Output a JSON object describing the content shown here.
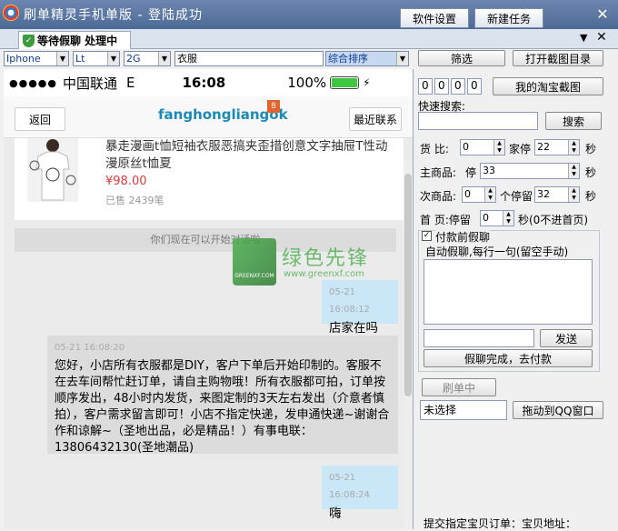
{
  "window": {
    "title": "刷单精灵手机单版 - 登陆成功",
    "software_settings": "软件设置",
    "new_task": "新建任务",
    "close": "✕"
  },
  "tab": {
    "label": "等待假聊 处理中",
    "ctrl": "▼",
    "close": "✕"
  },
  "filters": {
    "device": "Iphone",
    "network": "Lt",
    "signal": "2G",
    "keyword": "衣服",
    "sort": "综合排序"
  },
  "right": {
    "filter_btn": "筛选",
    "open_screenshots_btn": "打开截图目录",
    "digits": [
      "0",
      "0",
      "0",
      "0"
    ],
    "my_taobao_btn": "我的淘宝截图",
    "quick_search_label": "快速搜索:",
    "search_btn": "搜索",
    "goods_compare_label": "货  比:",
    "goods_compare_value": "0",
    "shop_stay_label": "家停",
    "shop_stay_value": "22",
    "sec1": "秒",
    "main_goods_label": "主商品:",
    "stay_label": "停",
    "main_goods_value": "33",
    "sec2": "秒",
    "sub_goods_label": "次商品:",
    "sub_goods_value": "0",
    "each_stay_label": "个停留",
    "sub_stay_value": "32",
    "sec3": "秒",
    "home_label": "首    页:停留",
    "home_value": "0",
    "home_note": "秒(0不进首页)",
    "pay_checkbox_label": "付款前假聊",
    "auto_chat_label": "自动假聊,每行一句(留空手动)",
    "send_btn": "发送",
    "done_btn": "假聊完成，去付款",
    "brush_btn": "刷单中",
    "unselected": "未选择",
    "drag_qq_btn": "拖动到QQ窗口",
    "footer_text": "提交指定宝贝订单：宝贝地址："
  },
  "phone": {
    "signal_dots": "●●●●●",
    "carrier": "中国联通",
    "network": "E",
    "time": "16:08",
    "battery": "100%",
    "back_btn": "返回",
    "contact_name": "fanghongliangok",
    "badge": "8",
    "recent_btn": "最近联系",
    "product_title": "暴走漫画t恤短袖衣服恶搞夹歪措创意文字抽屉T性动漫原丝t恤夏",
    "product_price": "¥98.00",
    "product_sold": "已售 2439笔",
    "system_msg": "你们现在可以开始对话啦",
    "messages": [
      {
        "time": "05-21 16:08:12",
        "text": "店家在吗",
        "side": "right"
      },
      {
        "time": "05-21 16:08:20",
        "text": "您好，小店所有衣服都是DIY，客户下单后开始印制的。客服不在去车间帮忙赶订单，请自主购物哦！所有衣服都可拍，订单按顺序发出，48小时内发货，来图定制的3天左右发出（介意者慎拍），客户需求留言即可！小店不指定快递，发申通快递~谢谢合作和谅解~（圣地出品，必是精品！）有事电联：13806432130(圣地潮品)",
        "side": "left"
      },
      {
        "time": "05-21 16:08:24",
        "text": "嗨",
        "side": "right"
      }
    ]
  },
  "watermark": {
    "cn": "绿色先锋",
    "en": "www.greenxf.com",
    "logo_text": "GREENXF.COM"
  },
  "colors": {
    "titlebar": "#4d6a96",
    "contact": "#1a8bb5",
    "price": "#e4393c",
    "right_bubble": "#c9e7f7",
    "left_bubble": "#dcdcdc"
  }
}
